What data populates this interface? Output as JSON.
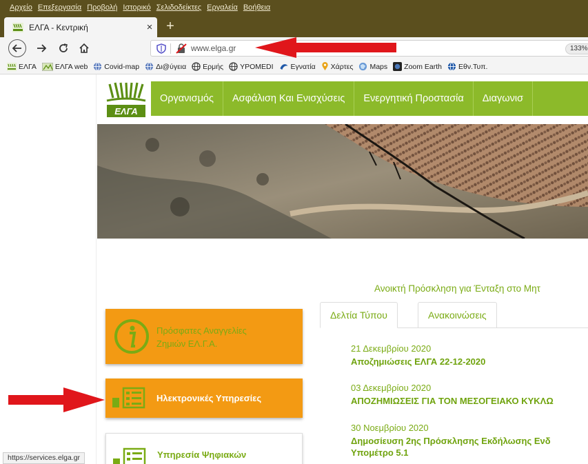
{
  "menubar": {
    "items": [
      "Αρχείο",
      "Επεξεργασία",
      "Προβολή",
      "Ιστορικό",
      "Σελιδοδείκτες",
      "Εργαλεία",
      "Βοήθεια"
    ]
  },
  "tab": {
    "title": "ΕΛΓΑ - Κεντρική",
    "close": "×"
  },
  "newtab": "+",
  "navbar": {
    "url": "www.elga.gr",
    "zoom": "133%"
  },
  "bookmarks": [
    {
      "label": "ΕΛΓΑ",
      "icon": "elga-icon"
    },
    {
      "label": "ΕΛΓΑ web",
      "icon": "elga-web-icon"
    },
    {
      "label": "Covid-map",
      "icon": "globe-icon"
    },
    {
      "label": "Δι@ύγεια",
      "icon": "globe-icon"
    },
    {
      "label": "Ερμής",
      "icon": "globe-icon"
    },
    {
      "label": "YPOMEDI",
      "icon": "globe-icon"
    },
    {
      "label": "Εγνατία",
      "icon": "egnatia-icon"
    },
    {
      "label": "Χάρτες",
      "icon": "map-pin-icon"
    },
    {
      "label": "Maps",
      "icon": "maps-icon"
    },
    {
      "label": "Zoom Earth",
      "icon": "zoom-earth-icon"
    },
    {
      "label": "Εθν.Τυπ.",
      "icon": "globe-icon"
    }
  ],
  "site": {
    "logo_text": "ΕΛΓΑ",
    "nav": [
      "Οργανισμός",
      "Ασφάλιση Και Ενισχύσεις",
      "Ενεργητική Προστασία",
      "Διαγωνισ"
    ],
    "announcement": "Ανοικτή Πρόσκληση για Ένταξη στο Μητ",
    "cards": {
      "first": {
        "line1": "Πρόσφατες Αναγγελίες",
        "line2": "Ζημιών ΕΛ.Γ.Α."
      },
      "second": "Ηλεκτρονικές Υπηρεσίες",
      "third": "Υπηρεσία Ψηφιακών"
    },
    "tabs": [
      "Δελτία Τύπου",
      "Ανακοινώσεις"
    ],
    "news": [
      {
        "date": "21 Δεκεμβρίου 2020",
        "headline": "Αποζημιώσεις ΕΛΓΑ 22-12-2020"
      },
      {
        "date": "03 Δεκεμβρίου 2020",
        "headline": "ΑΠΟΖΗΜΙΩΣΕΙΣ ΓΙΑ ΤΟΝ ΜΕΣΟΓΕΙΑΚΟ ΚΥΚΛΩ"
      },
      {
        "date": "30 Νοεμβρίου 2020",
        "headline": "Δημοσίευση 2ης Πρόσκλησης Εκδήλωσης Ενδ",
        "headline2": "Υπομέτρο 5.1"
      }
    ]
  },
  "statusbar": "https://services.elga.gr",
  "colors": {
    "accent_green": "#8cba2a",
    "orange": "#f39a13",
    "menubar": "#5b4f1e",
    "arrow_red": "#e0161b"
  }
}
